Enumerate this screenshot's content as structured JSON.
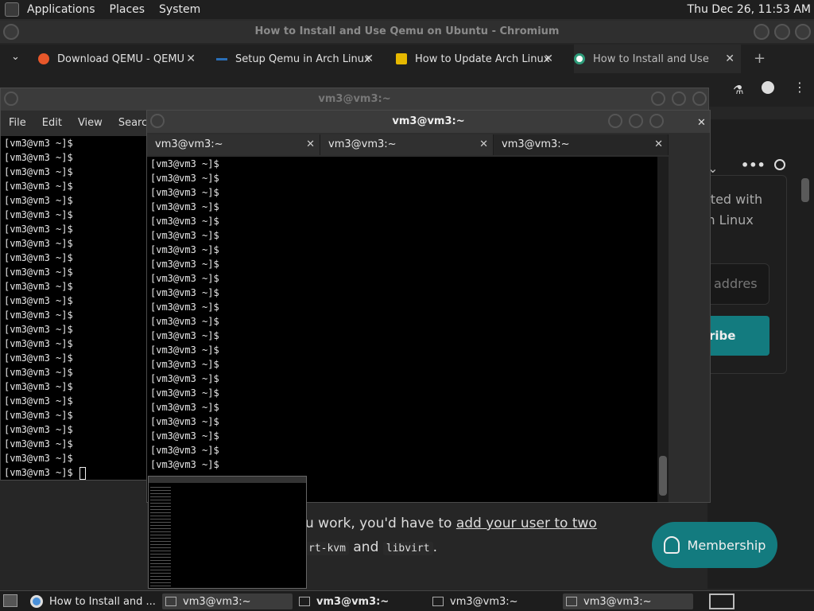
{
  "top_panel": {
    "menus": [
      "Applications",
      "Places",
      "System"
    ],
    "clock": "Thu Dec 26, 11:53 AM"
  },
  "browser": {
    "title": "How to Install and Use Qemu on Ubuntu - Chromium",
    "tabs": [
      {
        "label": "Download QEMU - QEMU",
        "favicon_color": "#e8572a"
      },
      {
        "label": "Setup Qemu in Arch Linux",
        "favicon_color": "#2a6fb8"
      },
      {
        "label": "How to Update Arch Linux",
        "favicon_color": "#e6b800"
      },
      {
        "label": "How to Install and Use Qe",
        "favicon_color": "#2e9c7a"
      }
    ],
    "new_tab": "+",
    "page": {
      "partial_text_1": "ated with",
      "partial_text_2": "m Linux",
      "input_placeholder": "addres",
      "subscribe_partial": "ribe",
      "body_line_1_prefix": "u work, you'd have to ",
      "body_line_1_link": "add your user to two",
      "body_line_2_code_1": "rt-kvm",
      "body_line_2_middle": " and ",
      "body_line_2_code_2": "libvirt",
      "body_line_2_end": ".",
      "membership_button": "Membership"
    }
  },
  "terminal_back": {
    "title": "vm3@vm3:~",
    "menus": [
      "File",
      "Edit",
      "View",
      "Search"
    ],
    "prompt": "[vm3@vm3 ~]$",
    "line_count": 24
  },
  "terminal_front": {
    "title": "vm3@vm3:~",
    "tabs": [
      "vm3@vm3:~",
      "vm3@vm3:~",
      "vm3@vm3:~"
    ],
    "prompt": "[vm3@vm3 ~]$",
    "line_count": 22
  },
  "taskbar": {
    "items": [
      {
        "label": "How to Install and ..."
      },
      {
        "label": "vm3@vm3:~"
      },
      {
        "label": "vm3@vm3:~"
      },
      {
        "label": "vm3@vm3:~"
      },
      {
        "label": "vm3@vm3:~"
      }
    ]
  }
}
